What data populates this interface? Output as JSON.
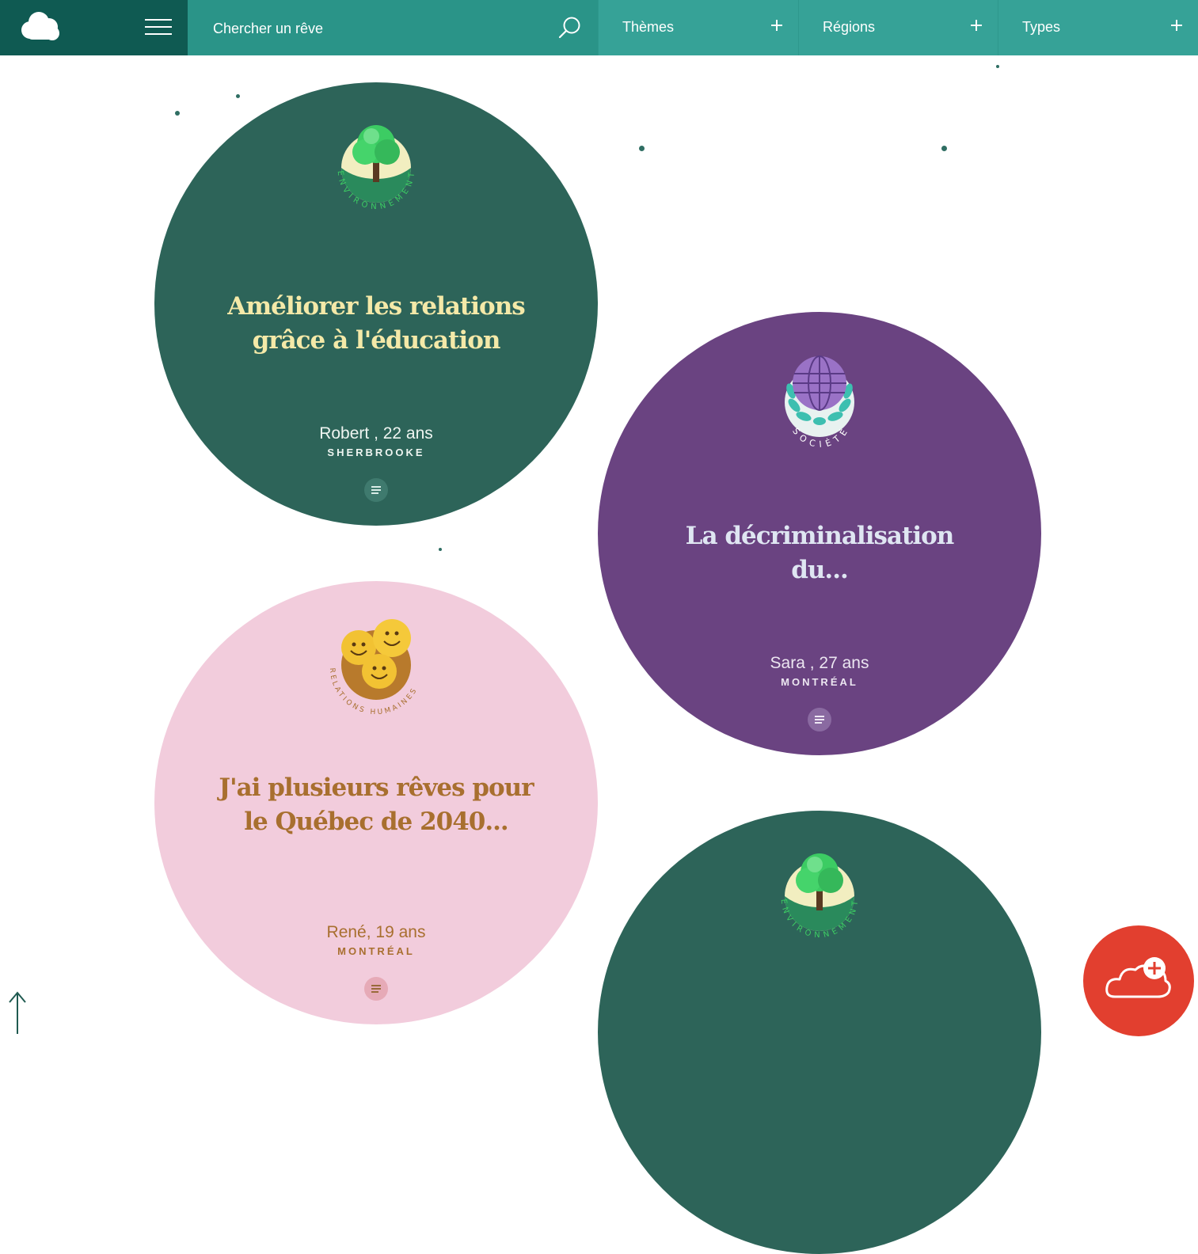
{
  "header": {
    "search_placeholder": "Chercher un rêve",
    "filters": [
      {
        "label": "Thèmes"
      },
      {
        "label": "Régions"
      },
      {
        "label": "Types"
      }
    ]
  },
  "dreams": [
    {
      "theme": "ENVIRONNEMENT",
      "title": "Améliorer les relations grâce à l'éducation",
      "author": "Robert , 22 ans",
      "city": "SHERBROOKE",
      "color": "#2d6459"
    },
    {
      "theme": "SOCIÉTÉ",
      "title": "La décriminalisation du...",
      "author": "Sara , 27 ans",
      "city": "MONTRÉAL",
      "color": "#6a4381"
    },
    {
      "theme": "RELATIONS HUMAINES",
      "title": "J'ai plusieurs rêves pour le Québec de 2040...",
      "author": "René, 19 ans",
      "city": "MONTRÉAL",
      "color": "#f2ccdc"
    },
    {
      "theme": "ENVIRONNEMENT",
      "color": "#2d6459"
    }
  ],
  "colors": {
    "brand": "#0f5a52",
    "search": "#2a9488",
    "filters": "#36a297",
    "add_button": "#e23f2f"
  },
  "icons": {
    "logo": "cloud-icon",
    "menu": "hamburger-icon",
    "search": "search-icon",
    "add": "cloud-plus-icon",
    "scroll_top": "arrow-up-icon"
  }
}
